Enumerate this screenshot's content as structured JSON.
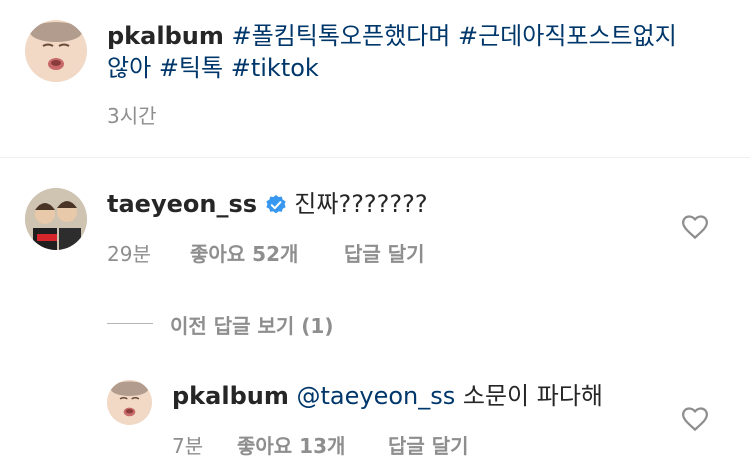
{
  "post": {
    "username": "pkalbum",
    "caption_tags": [
      "#폴킴틱톡오픈했다며",
      "#근데아직포스트없지",
      "않아",
      "#틱톡",
      "#tiktok"
    ],
    "time": "3시간"
  },
  "comment1": {
    "username": "taeyeon_ss",
    "text": "진짜???????",
    "time": "29분",
    "likes": "좋아요 52개",
    "reply": "답글 달기"
  },
  "view_replies": "이전 답글 보기 (1)",
  "reply1": {
    "username": "pkalbum",
    "mention": "@taeyeon_ss",
    "text": "소문이 파다해",
    "time": "7분",
    "likes": "좋아요 13개",
    "reply": "답글 달기"
  }
}
